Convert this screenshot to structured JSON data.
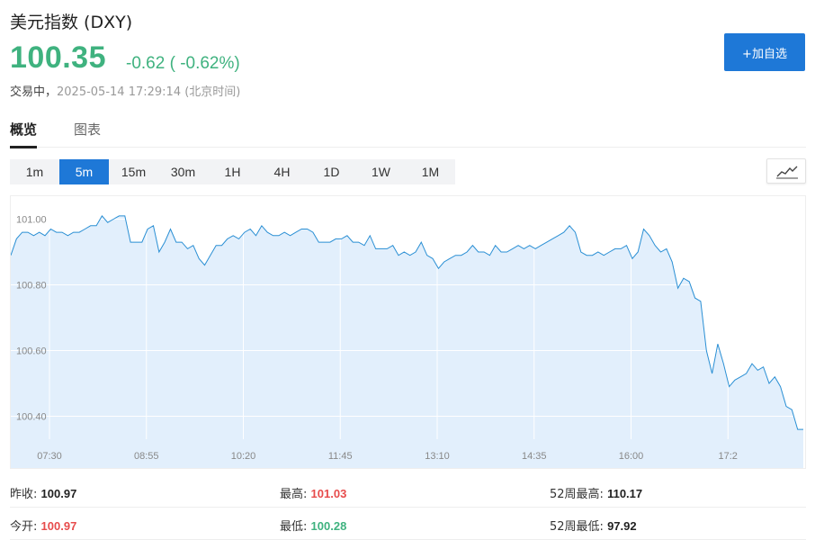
{
  "header": {
    "title": "美元指数 (DXY)",
    "price": "100.35",
    "change": "-0.62 ( -0.62%)",
    "state": "交易中，",
    "timestamp": "2025-05-14 17:29:14 (北京时间)",
    "add_button": "+加自选",
    "price_color": "#3fb27f",
    "accent": "#1e78d7"
  },
  "tabs": [
    {
      "label": "概览",
      "active": true
    },
    {
      "label": "图表",
      "active": false
    }
  ],
  "periods": [
    {
      "label": "1m",
      "active": false
    },
    {
      "label": "5m",
      "active": true
    },
    {
      "label": "15m",
      "active": false
    },
    {
      "label": "30m",
      "active": false
    },
    {
      "label": "1H",
      "active": false
    },
    {
      "label": "4H",
      "active": false
    },
    {
      "label": "1D",
      "active": false
    },
    {
      "label": "1W",
      "active": false
    },
    {
      "label": "1M",
      "active": false
    }
  ],
  "chart_type_icon": "line-chart-icon",
  "stats": {
    "prev_close_label": "昨收:",
    "prev_close": "100.97",
    "open_label": "今开:",
    "open": "100.97",
    "high_label": "最高:",
    "high": "101.03",
    "low_label": "最低:",
    "low": "100.28",
    "w52_high_label": "52周最高:",
    "w52_high": "110.17",
    "w52_low_label": "52周最低:",
    "w52_low": "97.92"
  },
  "chart_data": {
    "type": "area",
    "interval": "5m",
    "x_ticks": [
      "07:30",
      "08:55",
      "10:20",
      "11:45",
      "13:10",
      "14:35",
      "16:00",
      "17:2"
    ],
    "y_ticks": [
      "101.00",
      "100.80",
      "100.60",
      "100.40"
    ],
    "ylim": [
      100.33,
      101.07
    ],
    "grid": true,
    "line_color": "#2a8fd4",
    "fill_color": "#e2effc",
    "values": [
      100.89,
      100.94,
      100.96,
      100.96,
      100.95,
      100.96,
      100.95,
      100.97,
      100.96,
      100.96,
      100.95,
      100.96,
      100.96,
      100.97,
      100.98,
      100.98,
      101.01,
      100.99,
      101.0,
      101.01,
      101.01,
      100.93,
      100.93,
      100.93,
      100.97,
      100.98,
      100.9,
      100.93,
      100.97,
      100.93,
      100.93,
      100.91,
      100.92,
      100.88,
      100.86,
      100.89,
      100.92,
      100.92,
      100.94,
      100.95,
      100.94,
      100.96,
      100.97,
      100.95,
      100.98,
      100.96,
      100.95,
      100.95,
      100.96,
      100.95,
      100.96,
      100.97,
      100.97,
      100.96,
      100.93,
      100.93,
      100.93,
      100.94,
      100.94,
      100.95,
      100.93,
      100.93,
      100.92,
      100.95,
      100.91,
      100.91,
      100.91,
      100.92,
      100.89,
      100.9,
      100.89,
      100.9,
      100.93,
      100.89,
      100.88,
      100.85,
      100.87,
      100.88,
      100.89,
      100.89,
      100.9,
      100.92,
      100.9,
      100.9,
      100.89,
      100.92,
      100.9,
      100.9,
      100.91,
      100.92,
      100.91,
      100.92,
      100.91,
      100.92,
      100.93,
      100.94,
      100.95,
      100.96,
      100.98,
      100.96,
      100.9,
      100.89,
      100.89,
      100.9,
      100.89,
      100.9,
      100.91,
      100.91,
      100.92,
      100.88,
      100.9,
      100.97,
      100.95,
      100.92,
      100.9,
      100.91,
      100.87,
      100.79,
      100.82,
      100.81,
      100.76,
      100.75,
      100.6,
      100.53,
      100.62,
      100.56,
      100.49,
      100.51,
      100.52,
      100.53,
      100.56,
      100.54,
      100.55,
      100.5,
      100.52,
      100.49,
      100.43,
      100.42,
      100.36,
      100.36
    ]
  }
}
